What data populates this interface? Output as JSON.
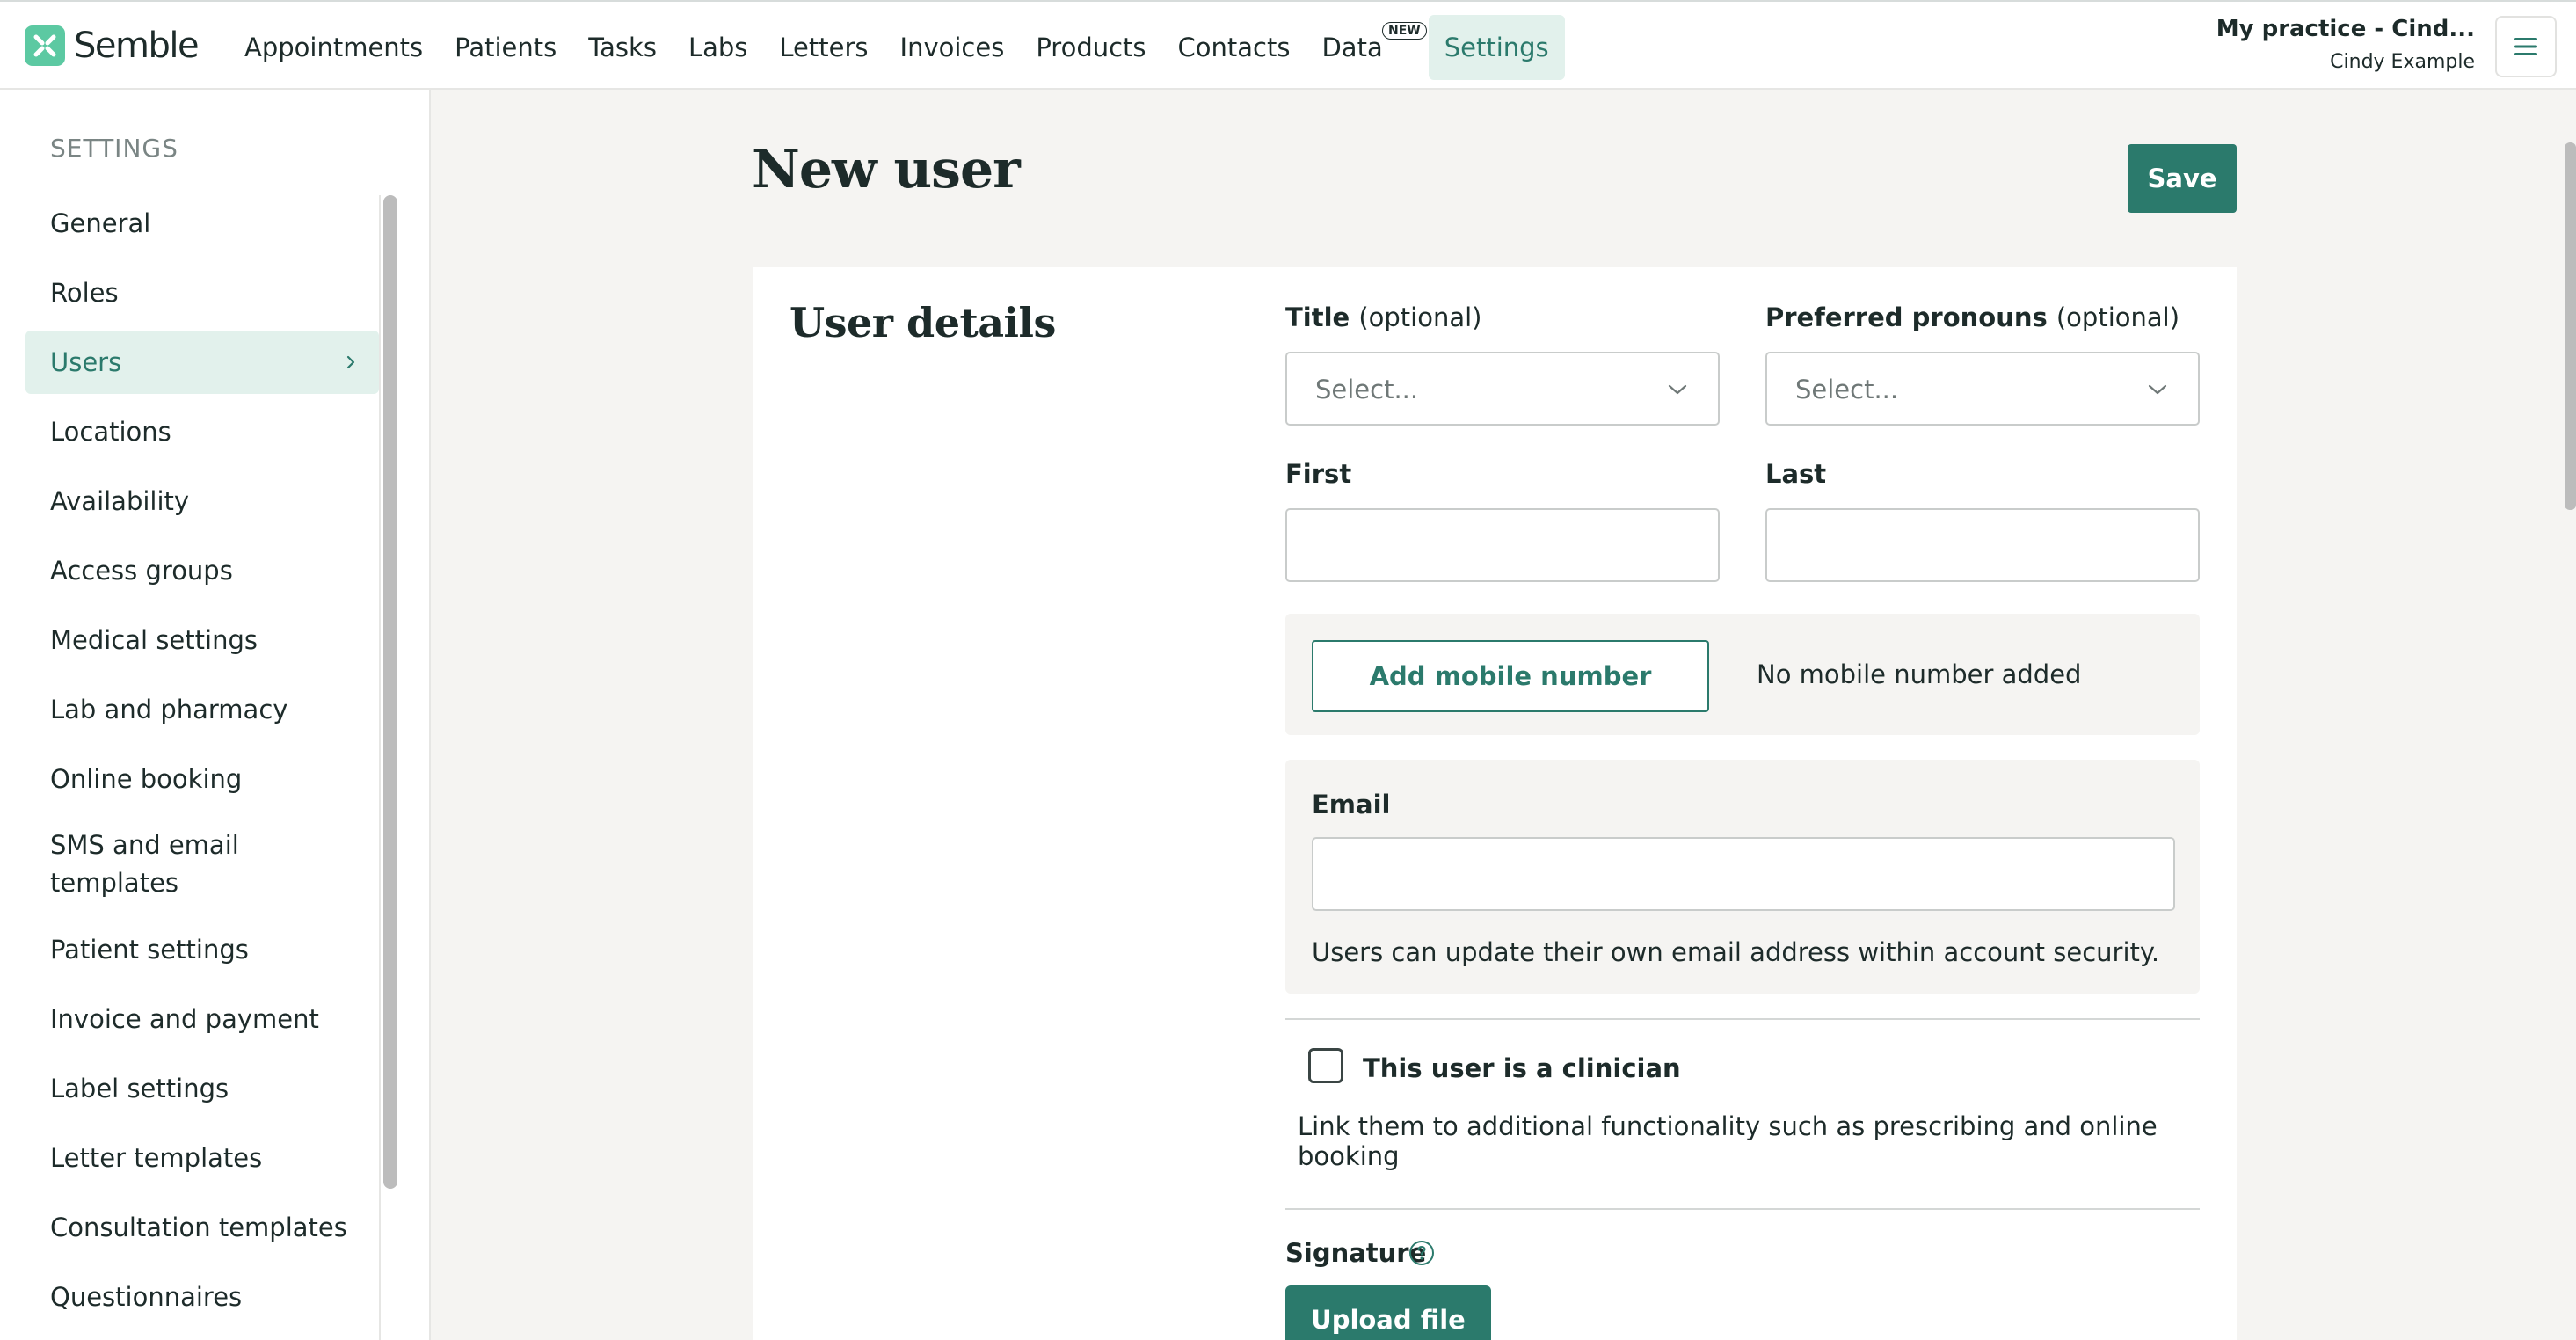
{
  "app": {
    "name": "Semble",
    "logo_icon": "semble-logo-icon"
  },
  "nav": {
    "items": [
      {
        "label": "Appointments"
      },
      {
        "label": "Patients"
      },
      {
        "label": "Tasks"
      },
      {
        "label": "Labs"
      },
      {
        "label": "Letters"
      },
      {
        "label": "Invoices"
      },
      {
        "label": "Products"
      },
      {
        "label": "Contacts"
      },
      {
        "label": "Data",
        "badge": "NEW"
      },
      {
        "label": "Settings",
        "active": true
      }
    ]
  },
  "account": {
    "practice": "My practice - Cind...",
    "user": "Cindy Example",
    "menu_icon": "hamburger-menu-icon"
  },
  "sidebar": {
    "title": "SETTINGS",
    "items": [
      {
        "label": "General"
      },
      {
        "label": "Roles"
      },
      {
        "label": "Users",
        "active": true
      },
      {
        "label": "Locations"
      },
      {
        "label": "Availability"
      },
      {
        "label": "Access groups"
      },
      {
        "label": "Medical settings"
      },
      {
        "label": "Lab and pharmacy"
      },
      {
        "label": "Online booking"
      },
      {
        "label": "SMS and email templates"
      },
      {
        "label": "Patient settings"
      },
      {
        "label": "Invoice and payment"
      },
      {
        "label": "Label settings"
      },
      {
        "label": "Letter templates"
      },
      {
        "label": "Consultation templates"
      },
      {
        "label": "Questionnaires"
      }
    ]
  },
  "page": {
    "title": "New user",
    "save_label": "Save"
  },
  "form": {
    "section_title": "User details",
    "title_field": {
      "label": "Title",
      "optional": "(optional)",
      "placeholder": "Select..."
    },
    "pronouns_field": {
      "label": "Preferred pronouns",
      "optional": "(optional)",
      "placeholder": "Select..."
    },
    "first_field": {
      "label": "First",
      "value": ""
    },
    "last_field": {
      "label": "Last",
      "value": ""
    },
    "mobile": {
      "button_label": "Add mobile number",
      "status": "No mobile number added"
    },
    "email": {
      "label": "Email",
      "value": "",
      "help": "Users can update their own email address within account security."
    },
    "clinician": {
      "label": "This user is a clinician",
      "checked": false,
      "description": "Link them to additional functionality such as prescribing and online booking"
    },
    "signature": {
      "label": "Signature",
      "upload_label": "Upload file"
    }
  },
  "colors": {
    "accent": "#2b7a6c",
    "accent_light": "#e2f1ec",
    "logo": "#5cc9a2",
    "page_bg": "#f5f4f2"
  }
}
